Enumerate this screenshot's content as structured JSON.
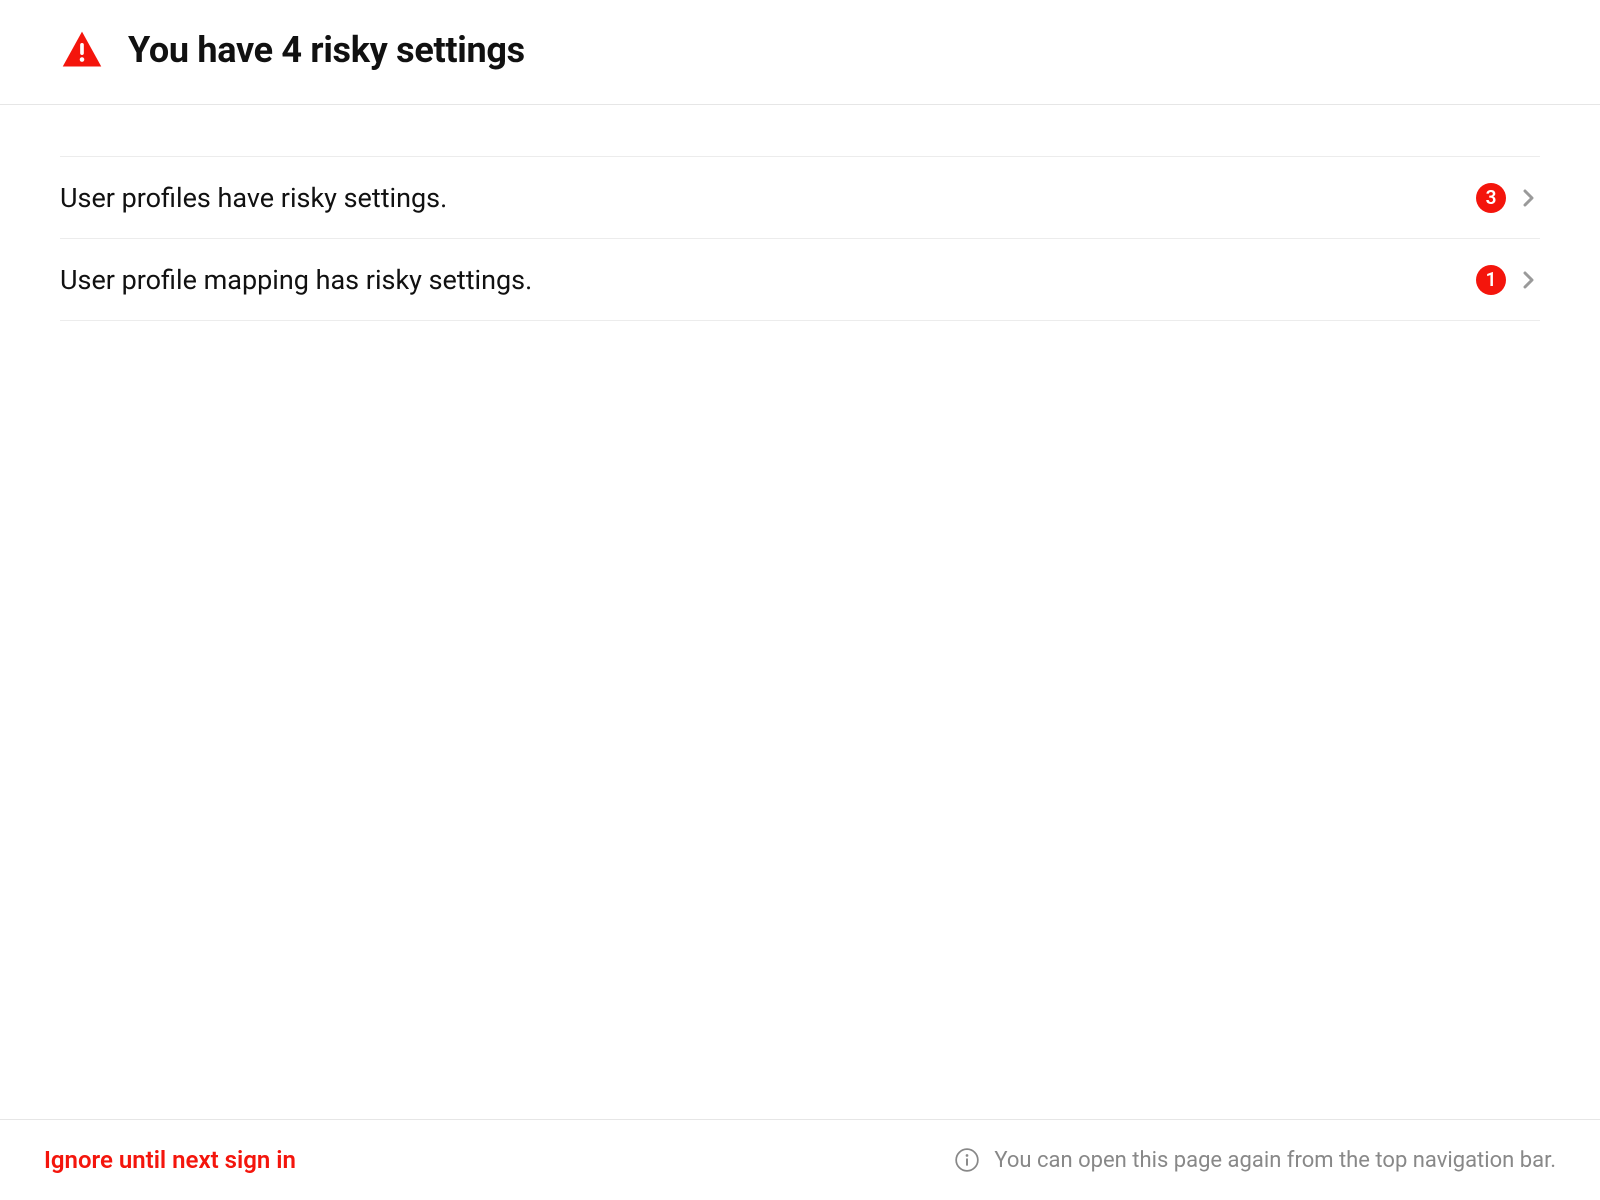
{
  "header": {
    "title": "You have 4 risky settings"
  },
  "items": [
    {
      "label": "User profiles have risky settings.",
      "count": "3"
    },
    {
      "label": "User profile mapping has risky settings.",
      "count": "1"
    }
  ],
  "footer": {
    "ignore_label": "Ignore until next sign in",
    "info_text": "You can open this page again from the top navigation bar."
  },
  "colors": {
    "accent_red": "#f4150c",
    "muted_gray": "#888888",
    "divider": "#e6e6e6"
  }
}
